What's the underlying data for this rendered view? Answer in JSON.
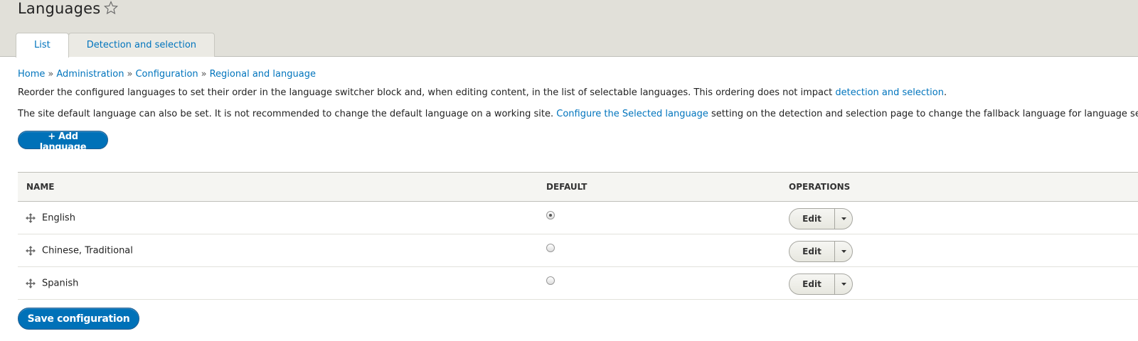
{
  "header": {
    "title": "Languages",
    "tabs": [
      {
        "label": "List",
        "active": true
      },
      {
        "label": "Detection and selection",
        "active": false
      }
    ]
  },
  "breadcrumb": [
    "Home",
    "Administration",
    "Configuration",
    "Regional and language"
  ],
  "breadcrumb_separator": "»",
  "description": {
    "line1_text": "Reorder the configured languages to set their order in the language switcher block and, when editing content, in the list of selectable languages. This ordering does not impact ",
    "line1_link": "detection and selection",
    "line1_end": ".",
    "line2_text": "The site default language can also be set. It is not recommended to change the default language on a working site. ",
    "line2_link": "Configure the Selected language",
    "line2_end": " setting on the detection and selection page to change the fallback language for language selection."
  },
  "add_language_label": "+ Add language",
  "table": {
    "headers": [
      "NAME",
      "DEFAULT",
      "OPERATIONS"
    ],
    "rows": [
      {
        "name": "English",
        "default": true,
        "operation": "Edit"
      },
      {
        "name": "Chinese, Traditional",
        "default": false,
        "operation": "Edit"
      },
      {
        "name": "Spanish",
        "default": false,
        "operation": "Edit"
      }
    ]
  },
  "save_label": "Save configuration",
  "colors": {
    "link": "#0074bd",
    "primary_button": "#0071b8",
    "header_bg": "#e1e0d9"
  },
  "icons": {
    "favorite": "star-icon",
    "drag": "drag-handle-icon",
    "dropdown": "chevron-down-icon"
  }
}
